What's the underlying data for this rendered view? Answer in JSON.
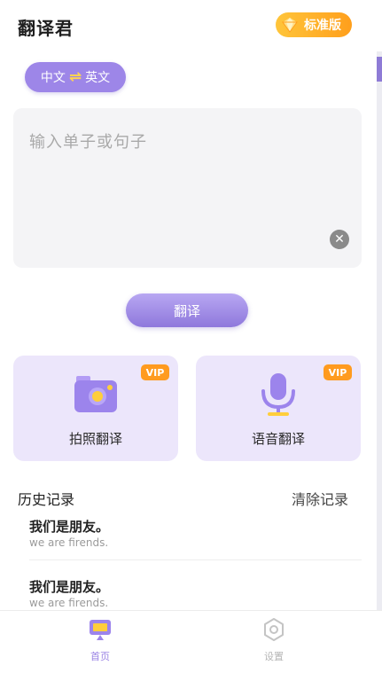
{
  "header": {
    "title": "翻译君",
    "badge_label": "标准版",
    "badge_icon": "gem-icon"
  },
  "language": {
    "source": "中文",
    "swap_icon": "swap-arrows-icon",
    "target": "英文"
  },
  "input": {
    "placeholder": "输入单子或句子",
    "value": "",
    "clear_icon": "clear-icon"
  },
  "translate_button": "翻译",
  "features": [
    {
      "label": "拍照翻译",
      "tag": "VIP",
      "icon": "camera-icon"
    },
    {
      "label": "语音翻译",
      "tag": "VIP",
      "icon": "microphone-icon"
    }
  ],
  "history": {
    "title": "历史记录",
    "clear_label": "清除记录",
    "items": [
      {
        "source": "我们是朋友。",
        "translation": "we are firends."
      },
      {
        "source": "我们是朋友。",
        "translation": "we are firends."
      }
    ]
  },
  "tabbar": {
    "items": [
      {
        "label": "首页",
        "icon": "home-screen-icon",
        "active": true
      },
      {
        "label": "设置",
        "icon": "gear-icon",
        "active": false
      }
    ]
  },
  "colors": {
    "accent": "#9d86e8",
    "badge": "#ffb02e",
    "vip": "#ff9b1f"
  }
}
